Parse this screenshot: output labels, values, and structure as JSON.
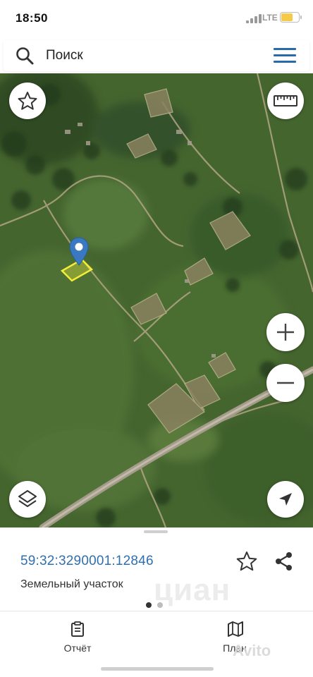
{
  "status_bar": {
    "time": "18:50",
    "network": "LTE",
    "battery_level": 0.65,
    "battery_color": "#f7c948"
  },
  "search": {
    "placeholder": "Поиск",
    "icon": "search-icon",
    "menu_icon": "hamburger-menu-icon",
    "accent": "#2b6aa8"
  },
  "map": {
    "controls": {
      "favorite": "star-icon",
      "ruler": "ruler-icon",
      "zoom_in": "plus-icon",
      "zoom_out": "minus-icon",
      "layers": "layers-icon",
      "location": "navigation-arrow-icon"
    },
    "marker_color": "#3a78c0",
    "parcel_color": "#f2ee38"
  },
  "parcel": {
    "cadastral_number": "59:32:3290001:12846",
    "type": "Земельный участок",
    "pager_active": 0,
    "pager_total": 2
  },
  "tabs": [
    {
      "label": "Отчёт",
      "icon": "report-icon"
    },
    {
      "label": "План",
      "icon": "map-icon"
    }
  ],
  "watermarks": {
    "cian": "циан",
    "avito": "Avito"
  }
}
